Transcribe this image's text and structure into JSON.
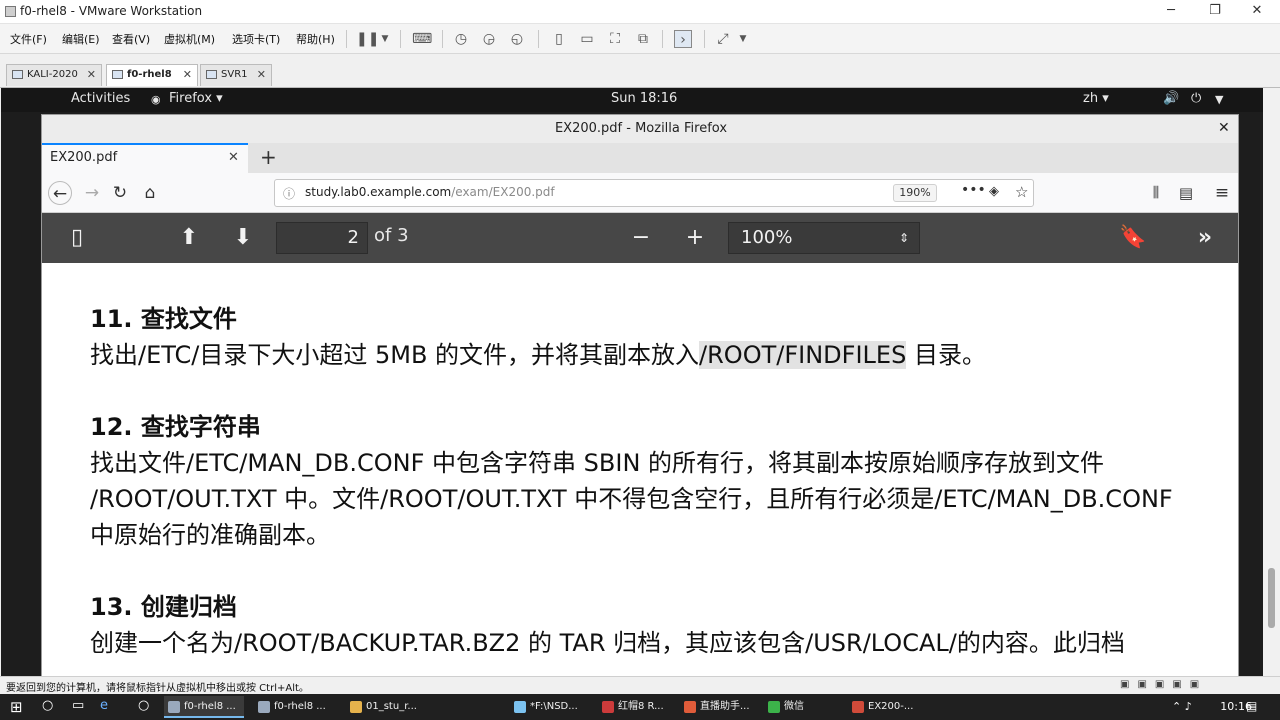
{
  "vmware": {
    "title": "f0-rhel8 - VMware Workstation",
    "menu": [
      "文件(F)",
      "编辑(E)",
      "查看(V)",
      "虚拟机(M)",
      "选项卡(T)",
      "帮助(H)"
    ],
    "tabs": [
      "KALI-2020",
      "f0-rhel8",
      "SVR1"
    ],
    "status_text": "要返回到您的计算机，请将鼠标指针从虚拟机中移出或按 Ctrl+Alt。"
  },
  "gnome": {
    "activities": "Activities",
    "app": "Firefox ▾",
    "clock": "Sun 18:16",
    "lang": "zh ▾"
  },
  "firefox": {
    "window_title": "EX200.pdf - Mozilla Firefox",
    "tab_title": "EX200.pdf",
    "url_domain": "study.lab0.example.com",
    "url_path": "/exam/EX200.pdf",
    "zoom": "190%"
  },
  "pdf": {
    "page_number": "2",
    "page_of": "of 3",
    "zoom": "100%",
    "sections": [
      {
        "title": "11.  查找文件",
        "lines": [
          [
            "找出/ETC/目录下大小超过 5MB 的文件，并将其副本放入",
            "/ROOT/FINDFILES",
            " 目录。"
          ]
        ]
      },
      {
        "title": "12.  查找字符串",
        "lines": [
          "找出文件/ETC/MAN_DB.CONF 中包含字符串 SBIN 的所有行，将其副本按原始顺序存放到文件",
          "/ROOT/OUT.TXT 中。文件/ROOT/OUT.TXT 中不得包含空行，且所有行必须是/ETC/MAN_DB.CONF",
          "中原始行的准确副本。"
        ]
      },
      {
        "title": "13.  创建归档",
        "lines": [
          "创建一个名为/ROOT/BACKUP.TAR.BZ2 的 TAR 归档，其应该包含/USR/LOCAL/的内容。此归档"
        ]
      }
    ]
  },
  "taskbar": {
    "items": [
      "f0-rhel8 ...",
      "f0-rhel8 ...",
      "01_stu_r...",
      "*F:\\NSD...",
      "红帽8 R...",
      "直播助手...",
      "微信",
      "EX200-..."
    ],
    "clock": "10:16"
  }
}
